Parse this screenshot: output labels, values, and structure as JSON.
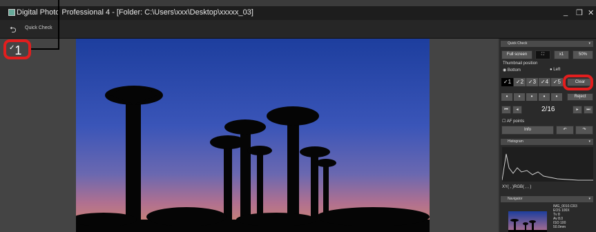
{
  "window": {
    "title": "Digital Photo Professional 4 - [Folder: C:\\Users\\xxx\\Desktop\\xxxxx_03]",
    "minimize_glyph": "_",
    "restore_glyph": "❒",
    "close_glyph": "✕"
  },
  "toolbar": {
    "back_glyph": "⮌",
    "quick_check_label": "Quick Check"
  },
  "image": {
    "rating_check": "✓",
    "rating_value": "1"
  },
  "panel": {
    "quick_check_header": "Quick Check",
    "full_screen": "Full screen",
    "zoom_x1": "x1",
    "zoom_percent": "50%",
    "thumbnail_position_label": "Thumbnail position",
    "option_bottom": "Bottom",
    "option_left": "Left",
    "ratings": [
      "✓1",
      "✓2",
      "✓3",
      "✓4",
      "✓5"
    ],
    "clear": "Clear",
    "reject": "Reject",
    "counter": "2/16",
    "af_points": "AF points",
    "info": "Info",
    "histogram_header": "Histogram",
    "histogram_readout": "XY(  ,  )RGB(  ,  ,  )",
    "navigator_header": "Navigator",
    "meta_lines": [
      "IMG_0010.CR3",
      "EOS 100X",
      "Tv 8",
      "Av 8.0",
      "ISO 100",
      "50.0mm"
    ]
  },
  "colors": {
    "callout": "#e21e1e",
    "leader": "#000000"
  }
}
